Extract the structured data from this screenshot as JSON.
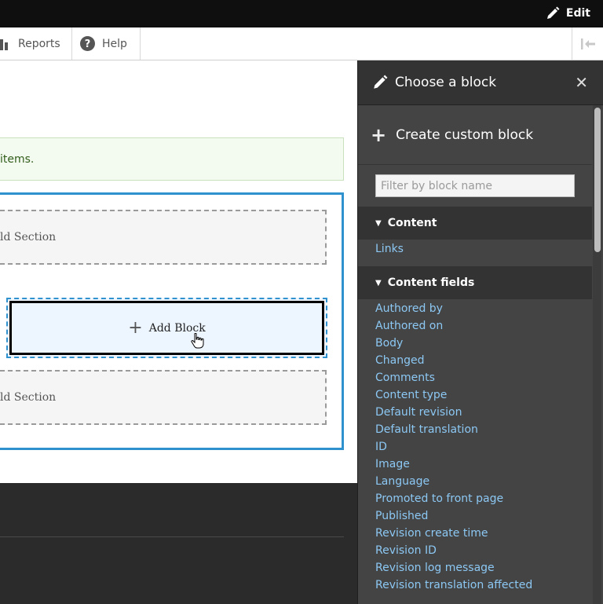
{
  "toolbar": {
    "edit_label": "Edit"
  },
  "secondary_toolbar": {
    "reports_label": "Reports",
    "help_label": "Help",
    "help_icon_glyph": "?"
  },
  "main": {
    "message_text": "items.",
    "add_section_top": "ld Section",
    "add_section_bottom": "ld Section",
    "add_block_label": "Add Block",
    "add_block_plus": "+"
  },
  "panel": {
    "title": "Choose a block",
    "close_glyph": "✕",
    "create_custom_label": "Create custom block",
    "create_custom_plus": "+",
    "filter_placeholder": "Filter by block name",
    "categories": [
      {
        "name": "Content",
        "items": [
          "Links"
        ]
      },
      {
        "name": "Content fields",
        "items": [
          "Authored by",
          "Authored on",
          "Body",
          "Changed",
          "Comments",
          "Content type",
          "Default revision",
          "Default translation",
          "ID",
          "Image",
          "Language",
          "Promoted to front page",
          "Published",
          "Revision create time",
          "Revision ID",
          "Revision log message",
          "Revision translation affected"
        ]
      }
    ],
    "triangle_glyph": "▼"
  },
  "colors": {
    "link": "#8cc8f4",
    "accent_blue": "#2f91ce",
    "panel_bg": "#444444",
    "panel_header_bg": "#333333",
    "message_bg": "#f3faef",
    "message_text": "#325e1c"
  }
}
